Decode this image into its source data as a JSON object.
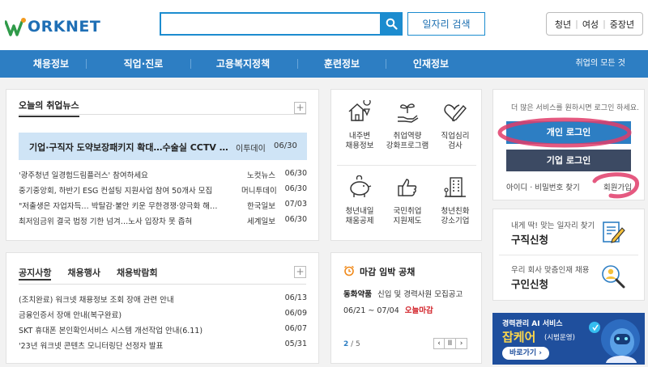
{
  "header": {
    "logo_text": "ORKNET",
    "search_button_label": "일자리 검색",
    "categories": [
      "청년",
      "여성",
      "중장년"
    ]
  },
  "nav": {
    "items": [
      "채용정보",
      "직업·진로",
      "고용복지정책",
      "훈련정보",
      "인재정보"
    ],
    "all_services": "취업의 모든 것"
  },
  "news": {
    "title": "오늘의 취업뉴스",
    "headline": {
      "title": "기업·구직자 도약보장패키지 확대…수술실 CCTV …",
      "source": "이투데이",
      "date": "06/30"
    },
    "items": [
      {
        "title": "'광주청년 일경험드림플러스' 참여하세요",
        "source": "노컷뉴스",
        "date": "06/30"
      },
      {
        "title": "중기중앙회, 하반기 ESG 컨설팅 지원사업 참여 50개사 모집",
        "source": "머니투데이",
        "date": "06/30"
      },
      {
        "title": "\"저출생은 자업자득… 박탈감·불안 키운 무한경쟁·양극화 해…",
        "source": "한국일보",
        "date": "07/03"
      },
      {
        "title": "최저임금위 결국 법정 기한 넘겨…노사 입장차 못 좁혀",
        "source": "세계일보",
        "date": "06/30"
      }
    ]
  },
  "notices": {
    "tabs": [
      "공지사항",
      "채용행사",
      "채용박람회"
    ],
    "items": [
      {
        "title": "(조치완료) 워크넷 채용정보 조회 장애 관련 안내",
        "date": "06/13"
      },
      {
        "title": "금융인증서 장애 안내(복구완료)",
        "date": "06/09"
      },
      {
        "title": "SKT 휴대폰 본인확인서비스 시스템 개선작업 안내(6.11)",
        "date": "06/07"
      },
      {
        "title": "'23년 워크넷 콘텐츠 모니터링단 선정자 발표",
        "date": "05/31"
      }
    ]
  },
  "services": [
    {
      "label1": "내주변",
      "label2": "채용정보",
      "icon": "house-location-icon"
    },
    {
      "label1": "취업역량",
      "label2": "강화프로그램",
      "icon": "sprout-hand-icon"
    },
    {
      "label1": "직업심리",
      "label2": "검사",
      "icon": "heart-pen-icon"
    },
    {
      "label1": "청년내일",
      "label2": "채움공제",
      "icon": "piggy-bank-icon"
    },
    {
      "label1": "국민취업",
      "label2": "지원제도",
      "icon": "thumbs-up-icon"
    },
    {
      "label1": "청년친화",
      "label2": "강소기업",
      "icon": "building-icon"
    }
  ],
  "deadline": {
    "title": "마감 임박 공채",
    "company": "동화약품",
    "job": "신입 및 경력사원 모집공고",
    "period": "06/21 ~ 07/04",
    "status": "오늘마감",
    "page_current": "2",
    "page_total": "/ 5"
  },
  "login": {
    "hint": "더 많은 서비스를 원하시면 로그인 하세요.",
    "personal_login": "개인 로그인",
    "corporate_login": "기업 로그인",
    "find_id_pw": "아이디 · 비밀번호 찾기",
    "signup": "회원가입"
  },
  "job_seek": {
    "subtitle": "내게 딱! 맞는 일자리 찾기",
    "title": "구직신청"
  },
  "job_offer": {
    "subtitle": "우리 회사 맞춤인재 채용",
    "title": "구인신청"
  },
  "ad": {
    "line1": "경력관리 AI 서비스",
    "brand": "잡케어",
    "pilot": "(시범운영)",
    "cta": "바로가기 ›"
  },
  "colors": {
    "primary": "#2d7ec3",
    "dark_button": "#3c4a63",
    "highlight": "#e03c6a"
  }
}
